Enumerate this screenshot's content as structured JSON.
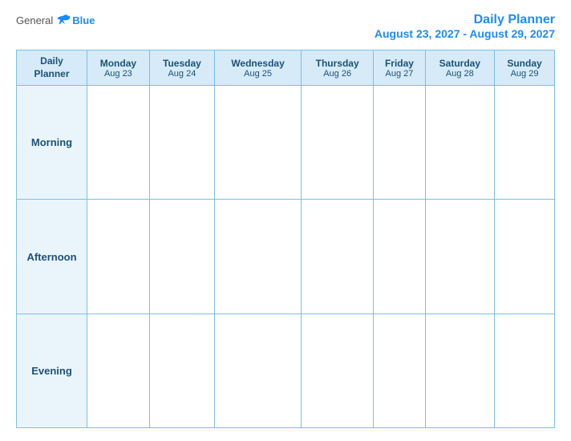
{
  "header": {
    "logo_general": "General",
    "logo_blue": "Blue",
    "title": "Daily Planner",
    "date_range": "August 23, 2027 - August 29, 2027"
  },
  "table": {
    "header_col": {
      "line1": "Daily",
      "line2": "Planner"
    },
    "days": [
      {
        "name": "Monday",
        "date": "Aug 23"
      },
      {
        "name": "Tuesday",
        "date": "Aug 24"
      },
      {
        "name": "Wednesday",
        "date": "Aug 25"
      },
      {
        "name": "Thursday",
        "date": "Aug 26"
      },
      {
        "name": "Friday",
        "date": "Aug 27"
      },
      {
        "name": "Saturday",
        "date": "Aug 28"
      },
      {
        "name": "Sunday",
        "date": "Aug 29"
      }
    ],
    "time_slots": [
      {
        "label": "Morning"
      },
      {
        "label": "Afternoon"
      },
      {
        "label": "Evening"
      }
    ]
  }
}
